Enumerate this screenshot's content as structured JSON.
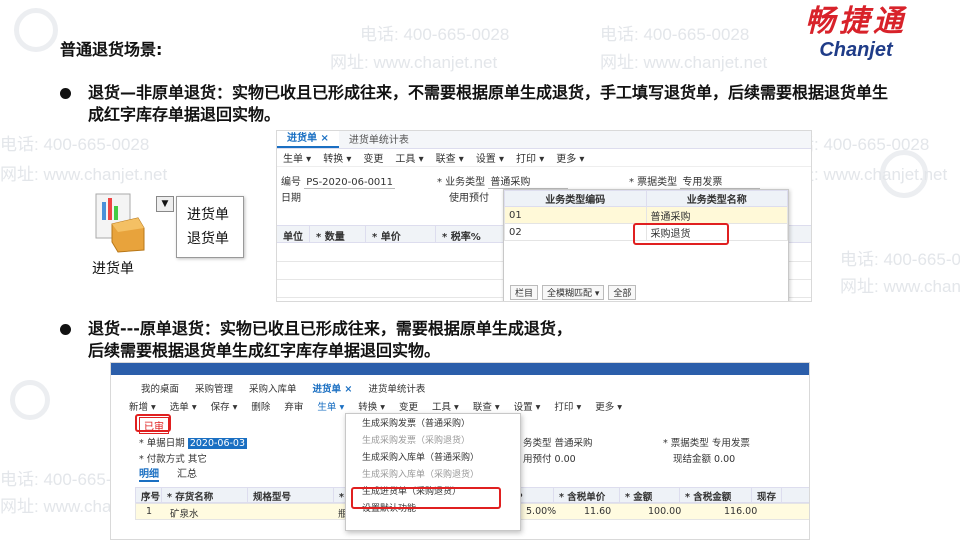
{
  "brand": {
    "cn": "畅捷通",
    "en": "Chanjet"
  },
  "watermark": {
    "phone": "电话: 400-665-0028",
    "site": "网址: www.chanjet.net"
  },
  "title": "普通退货场景:",
  "bullets": [
    {
      "text": "退货—非原单退货：实物已收且已形成往来，不需要根据原单生成退货，手工填写退货单，后续需要根据退货单生成红字库存单据退回实物。"
    },
    {
      "line1": "退货---原单退货：实物已收且已形成往来，需要根据原单生成退货，",
      "line2": "后续需要根据退货单生成红字库存单据退回实物。"
    }
  ],
  "icon_widget": {
    "menu": [
      "进货单",
      "退货单"
    ],
    "label": "进货单",
    "arrow": "▼"
  },
  "shot1": {
    "tabs": [
      "进货单 ×",
      "进货单统计表"
    ],
    "toolbar": [
      "生单 ▾",
      "转换 ▾",
      "变更",
      "工具 ▾",
      "联查 ▾",
      "设置 ▾",
      "打印 ▾",
      "更多 ▾"
    ],
    "doc_no_label": "编号",
    "doc_no": "PS-2020-06-0011",
    "date_label": "日期",
    "biz_type_label": "* 业务类型",
    "biz_type": "普通采购",
    "use_prepay_label": "使用预付",
    "invoice_type_label": "* 票据类型",
    "invoice_type": "专用发票",
    "grid_headers": [
      "单位",
      "* 数量",
      "* 单价",
      "* 税率%"
    ],
    "popup": {
      "headers": [
        "业务类型编码",
        "业务类型名称"
      ],
      "rows": [
        {
          "code": "01",
          "name": "普通采购"
        },
        {
          "code": "02",
          "name": "采购退货"
        }
      ],
      "footer": [
        "栏目",
        "全模糊匹配 ▾",
        "全部"
      ]
    }
  },
  "shot2": {
    "nav": [
      "我的桌面",
      "采购管理",
      "采购入库单",
      "进货单 ×",
      "进货单统计表"
    ],
    "toolbar": [
      "新增 ▾",
      "选单 ▾",
      "保存 ▾",
      "删除",
      "弃审",
      "生单 ▾",
      "转换 ▾",
      "变更",
      "工具 ▾",
      "联查 ▾",
      "设置 ▾",
      "打印 ▾",
      "更多 ▾"
    ],
    "status": "已审",
    "date_label": "* 单据日期",
    "date": "2020-06-03",
    "pay_label": "* 付款方式",
    "pay": "其它",
    "biz_type_label": "务类型",
    "biz_type": "普通采购",
    "prepay_label": "用预付",
    "prepay": "0.00",
    "invoice_label": "* 票据类型",
    "invoice": "专用发票",
    "cash_label": "现结金额",
    "cash": "0.00",
    "detail_tabs": [
      "明细",
      "汇总"
    ],
    "grid_headers": [
      "序号",
      "* 存货名称",
      "规格型号",
      "* 单",
      "",
      "%",
      "* 含税单价",
      "* 金额",
      "* 含税金额",
      "现存"
    ],
    "row": {
      "no": "1",
      "name": "矿泉水",
      "mid": "瓶",
      "rate": "5.00%",
      "tax_price": "11.60",
      "amount": "100.00",
      "tax_amount": "116.00"
    },
    "menu": [
      {
        "label": "生成采购发票（普通采购）",
        "dim": false
      },
      {
        "label": "生成采购发票（采购退货）",
        "dim": true
      },
      {
        "label": "生成采购入库单（普通采购）",
        "dim": false
      },
      {
        "label": "生成采购入库单（采购退货）",
        "dim": true
      },
      {
        "label": "生成进货单（采购退货）",
        "dim": false
      },
      {
        "label": "设置默认功能",
        "dim": false
      }
    ]
  }
}
